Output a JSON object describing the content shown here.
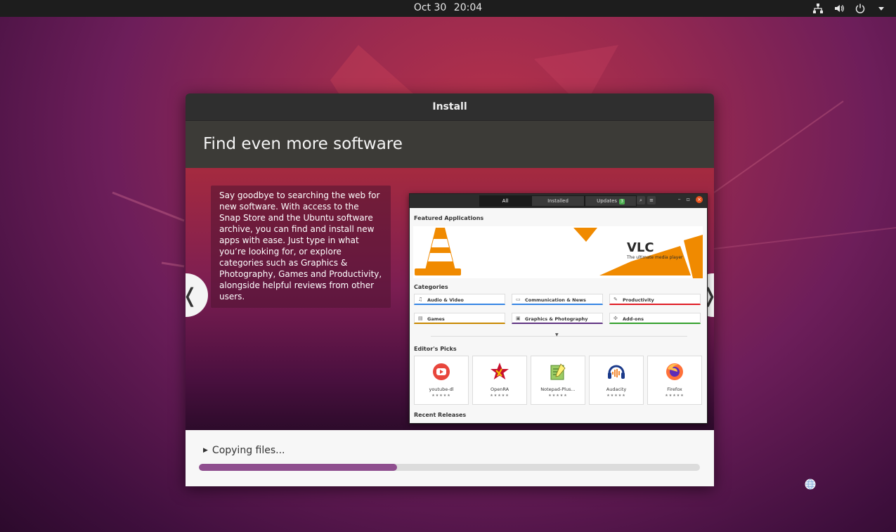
{
  "topbar": {
    "date": "Oct 30",
    "time": "20:04"
  },
  "dialog": {
    "title": "Install",
    "heading": "Find even more software"
  },
  "slide": {
    "description": "Say goodbye to searching the web for new software. With access to the Snap Store and the Ubuntu software archive, you can find and install new apps with ease. Just type in what you’re looking for, or explore categories such as Graphics & Photography, Games and Productivity, alongside helpful reviews from other users.",
    "prev_label": "❬",
    "next_label": "❭"
  },
  "software_window": {
    "tabs": [
      {
        "label": "All"
      },
      {
        "label": "Installed"
      },
      {
        "label": "Updates"
      }
    ],
    "updates_badge": "3",
    "featured_title": "Featured Applications",
    "banner": {
      "name": "VLC",
      "tagline": "The ultimate media player"
    },
    "categories_title": "Categories",
    "categories": [
      {
        "label": "Audio & Video",
        "icon": "music-note-icon",
        "color": "#3584e4"
      },
      {
        "label": "Communication & News",
        "icon": "chat-icon",
        "color": "#3584e4"
      },
      {
        "label": "Productivity",
        "icon": "edit-icon",
        "color": "#e01b24"
      },
      {
        "label": "Games",
        "icon": "gamepad-icon",
        "color": "#c88800"
      },
      {
        "label": "Graphics & Photography",
        "icon": "image-icon",
        "color": "#613583"
      },
      {
        "label": "Add-ons",
        "icon": "puzzle-icon",
        "color": "#33a02c"
      }
    ],
    "picks_title": "Editor's Picks",
    "picks": [
      {
        "name": "youtube-dl",
        "stars": "★★★★★"
      },
      {
        "name": "OpenRA",
        "stars": "★★★★★"
      },
      {
        "name": "Notepad-Plus...",
        "stars": "★★★★★"
      },
      {
        "name": "Audacity",
        "stars": "★★★★★"
      },
      {
        "name": "Firefox",
        "stars": "★★★★★"
      }
    ],
    "recent_title": "Recent Releases"
  },
  "progress": {
    "status": "Copying files...",
    "fraction": 0.396
  },
  "colors": {
    "accent": "#8f4f8f",
    "ubuntu_orange": "#e95420"
  }
}
